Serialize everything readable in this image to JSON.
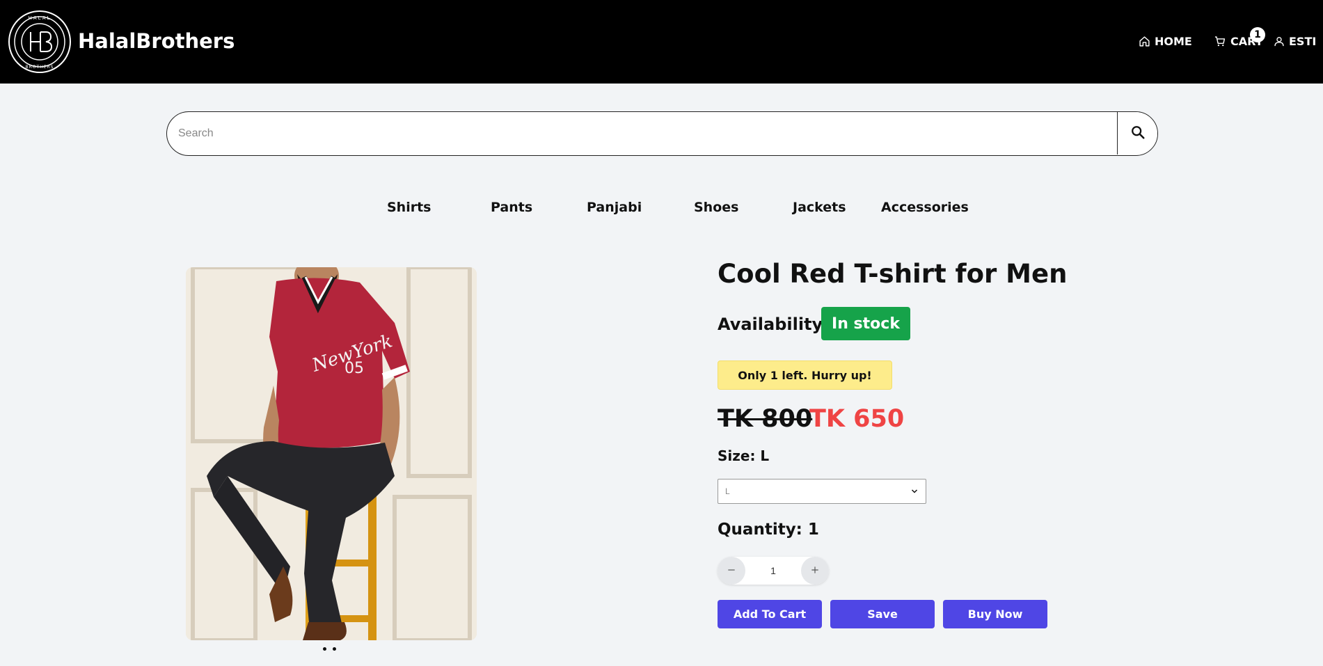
{
  "header": {
    "brand": "HalalBrothers",
    "logo_text": "HALAL BROTHERS",
    "nav": {
      "home": "HOME",
      "cart": "CART",
      "cart_count": "1",
      "user": "ESTI"
    }
  },
  "search": {
    "placeholder": "Search"
  },
  "categories": [
    "Shirts",
    "Pants",
    "Panjabi",
    "Shoes",
    "Jackets",
    "Accessories"
  ],
  "product": {
    "title": "Cool Red T-shirt for Men",
    "availability_label": "Availability :",
    "stock_status": "In stock",
    "stock_notice": "Only 1 left. Hurry up!",
    "old_price": "TK 800",
    "new_price": "TK 650",
    "size_label": "Size: L",
    "size_selected": "L",
    "quantity_label": "Quantity: 1",
    "quantity_value": "1",
    "buttons": {
      "add_to_cart": "Add To Cart",
      "save": "Save",
      "buy_now": "Buy Now"
    },
    "image_slides": 2,
    "colors": {
      "stock_badge": "#16a34a",
      "notice_bg": "#fdec8b",
      "sale_price": "#ef4444",
      "button": "#4f46e5"
    }
  }
}
